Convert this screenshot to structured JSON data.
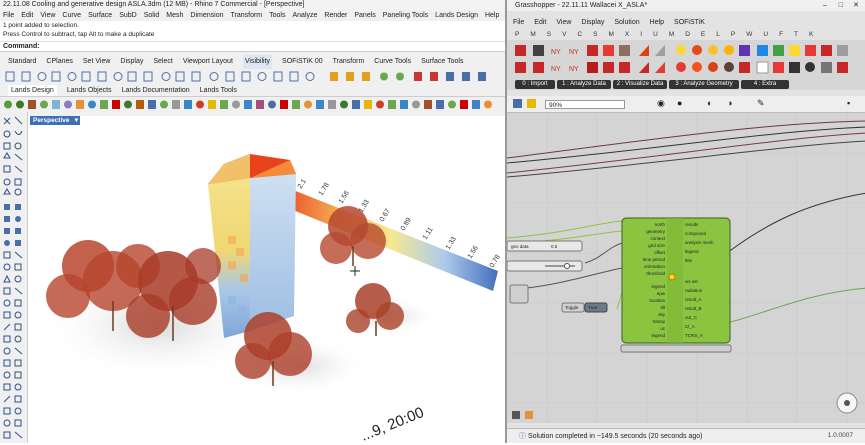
{
  "rhino": {
    "title": "22.11.08 Cooling and generative design ASLA.3dm (12 MB) - Rhino 7 Commercial - [Perspective]",
    "menu": [
      "File",
      "Edit",
      "View",
      "Curve",
      "Surface",
      "SubD",
      "Solid",
      "Mesh",
      "Dimension",
      "Transform",
      "Tools",
      "Analyze",
      "Render",
      "Panels",
      "Paneling Tools",
      "Lands Design",
      "Help"
    ],
    "messages": [
      "1 point added to selection.",
      "Press Control to subtract, tap Alt to make a duplicate"
    ],
    "command_label": "Command:",
    "toolbar_tabs": [
      "Standard",
      "CPlanes",
      "Set View",
      "Display",
      "Select",
      "Viewport Layout",
      "Visibility",
      "SOFiSTiK 00",
      "Transform",
      "Curve Tools",
      "Surface Tools"
    ],
    "lands_tabs": [
      "Lands Design",
      "Lands Objects",
      "Lands Documentation",
      "Lands Tools"
    ],
    "viewport_label": "Perspective",
    "legend_values": [
      "2.1",
      "1.78",
      "1.56",
      "1.33",
      "0.67",
      "0.89",
      "1.11",
      "1.33",
      "1.56",
      "0.78"
    ],
    "date_label": "...9, 20:00"
  },
  "gh": {
    "title": "Grasshopper - 22.11.11 Wallacei X_ASLA*",
    "menu": [
      "File",
      "Edit",
      "View",
      "Display",
      "Solution",
      "Help",
      "SOFiSTiK"
    ],
    "categories": [
      "P",
      "M",
      "S",
      "V",
      "C",
      "S",
      "M",
      "X",
      "I",
      "U",
      "M",
      "D",
      "E",
      "L",
      "P",
      "W",
      "U",
      "F",
      "T",
      "K"
    ],
    "groups": [
      "0 : Import",
      "1 : Analyze Data",
      "2 : Visualize Data",
      "3 : Analyze Geometry",
      "4 : Extra"
    ],
    "zoom": "90%",
    "status": "Solution completed in ~149.5 seconds (20 seconds ago)",
    "version": "1.0.0007",
    "component_inputs": [
      "north",
      "geometry",
      "context",
      "grid size",
      "offset",
      "time period",
      "orientation",
      "threshold",
      "legend",
      "epw",
      "location",
      "tilt",
      "sky",
      "transp",
      "uc",
      "legend",
      "ht",
      "run"
    ],
    "component_outputs": [
      "results",
      "compound",
      "analysis mesh",
      "legend",
      "title",
      "vis set",
      "radiation",
      "result_A",
      "result_B",
      "out_C",
      "Cl_A",
      "TCRS_A"
    ],
    "number_slider_value": "0.5",
    "panel_label": "Toggle",
    "panel_value": "True"
  },
  "colors": {
    "accent": "#3f6fb5",
    "component": "#8bc53f",
    "heat_red": "#e8431c"
  }
}
